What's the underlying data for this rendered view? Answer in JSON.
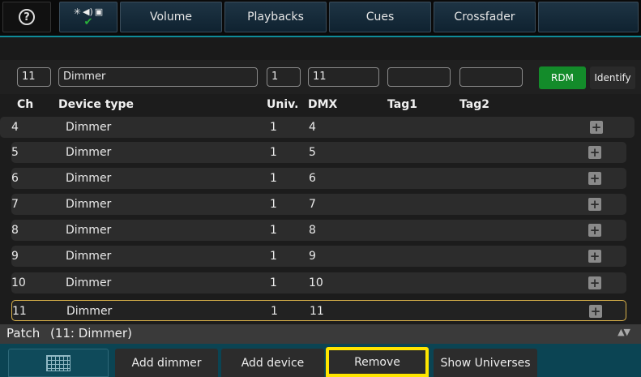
{
  "topbar": {
    "help_icon_text": "?",
    "status_icons": [
      "sun-icon",
      "speaker-icon",
      "image-icon",
      "check-icon"
    ],
    "tabs": [
      {
        "label": "Volume"
      },
      {
        "label": "Playbacks"
      },
      {
        "label": "Cues"
      },
      {
        "label": "Crossfader"
      },
      {
        "label": ""
      }
    ]
  },
  "fields": {
    "channel": "11",
    "device_type": "Dimmer",
    "universe": "1",
    "dmx": "11",
    "tag1": "",
    "tag2": "",
    "rdm_label": "RDM",
    "identify_label": "Identify"
  },
  "table": {
    "headers": [
      "Ch",
      "Device type",
      "Univ.",
      "DMX",
      "Tag1",
      "Tag2"
    ],
    "rows": [
      {
        "ch": "4",
        "device": "Dimmer",
        "univ": "1",
        "dmx": "4"
      },
      {
        "ch": "5",
        "device": "Dimmer",
        "univ": "1",
        "dmx": "5"
      },
      {
        "ch": "6",
        "device": "Dimmer",
        "univ": "1",
        "dmx": "6"
      },
      {
        "ch": "7",
        "device": "Dimmer",
        "univ": "1",
        "dmx": "7"
      },
      {
        "ch": "8",
        "device": "Dimmer",
        "univ": "1",
        "dmx": "8"
      },
      {
        "ch": "9",
        "device": "Dimmer",
        "univ": "1",
        "dmx": "9"
      },
      {
        "ch": "10",
        "device": "Dimmer",
        "univ": "1",
        "dmx": "10"
      },
      {
        "ch": "11",
        "device": "Dimmer",
        "univ": "1",
        "dmx": "11"
      }
    ],
    "selected_index": 7
  },
  "patch": {
    "label": "Patch",
    "detail": "(11: Dimmer)"
  },
  "bottombar": {
    "buttons": [
      {
        "label": ""
      },
      {
        "label": "Add dimmer"
      },
      {
        "label": "Add device"
      },
      {
        "label": "Remove"
      },
      {
        "label": "Show Universes"
      }
    ]
  },
  "colors": {
    "accent_teal": "#0f8b99",
    "rdm_green": "#138b2a",
    "highlight_yellow": "#ffe600",
    "selected_border": "#d9b14a"
  }
}
